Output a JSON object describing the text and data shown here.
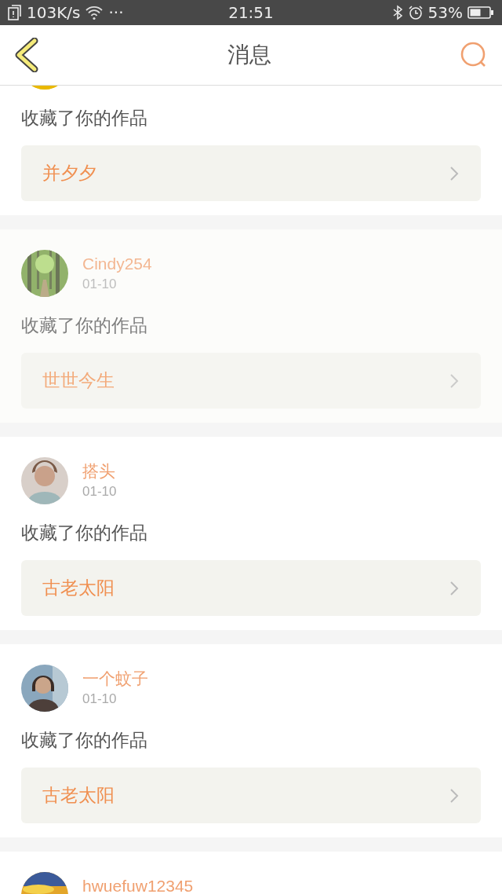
{
  "status_bar": {
    "speed": "103K/s",
    "more": "···",
    "time": "21:51",
    "battery": "53%"
  },
  "header": {
    "title": "消息"
  },
  "messages": [
    {
      "action": "收藏了你的作品",
      "work": "并夕夕",
      "selected": false
    },
    {
      "name": "Cindy254",
      "date": "01-10",
      "action": "收藏了你的作品",
      "work": "世世今生",
      "selected": true
    },
    {
      "name": "搭头",
      "date": "01-10",
      "action": "收藏了你的作品",
      "work": "古老太阳",
      "selected": false
    },
    {
      "name": "一个蚊子",
      "date": "01-10",
      "action": "收藏了你的作品",
      "work": "古老太阳",
      "selected": false
    },
    {
      "name": "hwuefuw12345",
      "selected": false
    }
  ]
}
